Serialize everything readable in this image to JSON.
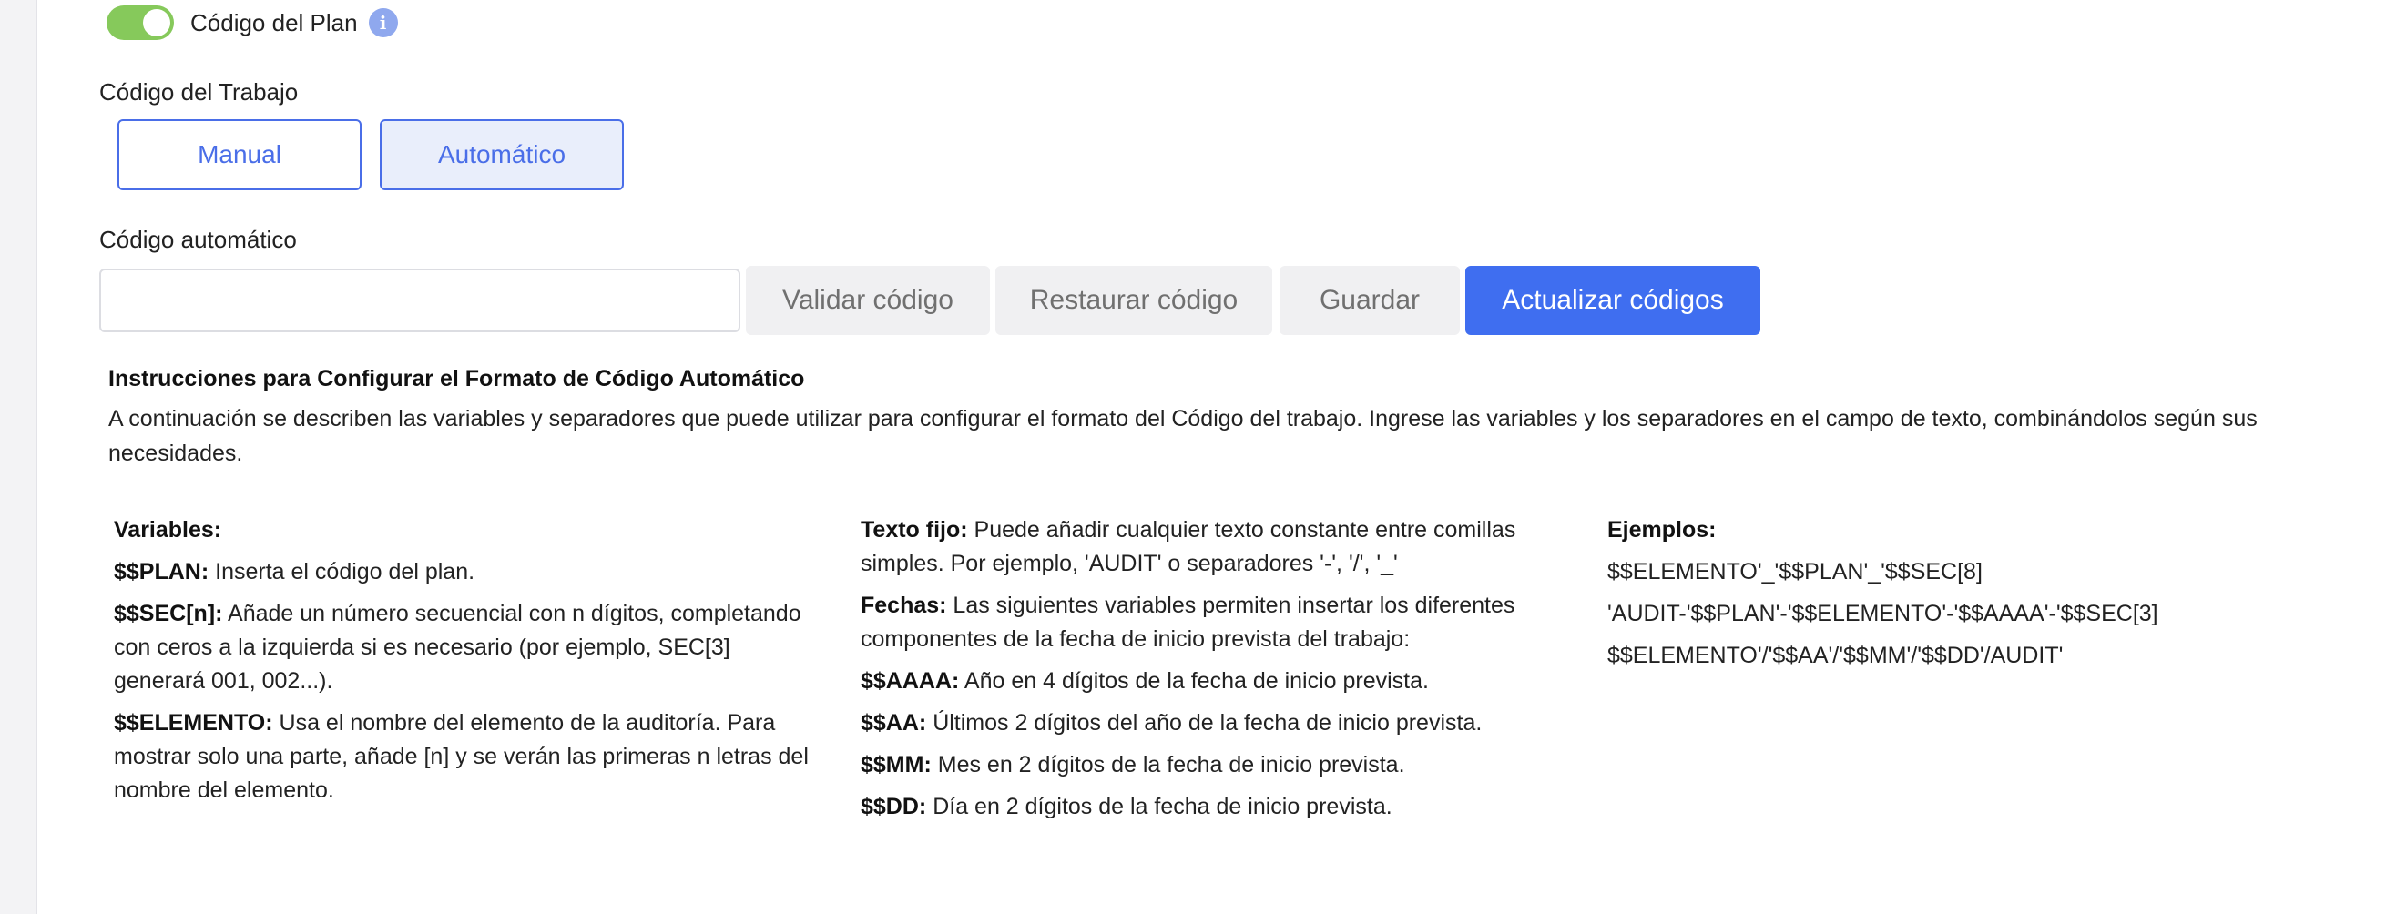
{
  "toggle": {
    "label": "Código del Plan",
    "on": true,
    "info_icon": "i"
  },
  "trabajo": {
    "label": "Código del Trabajo",
    "options": [
      "Manual",
      "Automático"
    ],
    "selected": "Automático"
  },
  "auto_code": {
    "label": "Código automático",
    "input_value": "",
    "buttons": {
      "validar": "Validar código",
      "restaurar": "Restaurar código",
      "guardar": "Guardar",
      "actualizar": "Actualizar códigos"
    }
  },
  "instructions": {
    "title": "Instrucciones para Configurar el Formato de Código Automático",
    "description": "A continuación se describen las variables y separadores que puede utilizar para configurar el formato del Código del trabajo. Ingrese las variables y los separadores en el campo de texto, combinándolos según sus necesidades."
  },
  "variables": {
    "heading": "Variables:",
    "items": [
      {
        "key": "$$PLAN:",
        "text": " Inserta el código del plan."
      },
      {
        "key": "$$SEC[n]:",
        "text": " Añade un número secuencial con n dígitos, completando con ceros a la izquierda si es necesario (por ejemplo, SEC[3] generará 001, 002...)."
      },
      {
        "key": "$$ELEMENTO:",
        "text": " Usa el nombre del elemento de la auditoría. Para mostrar solo una parte, añade [n] y se verán las primeras n letras del nombre del elemento."
      }
    ]
  },
  "fechas": {
    "items": [
      {
        "key": "Texto fijo:",
        "text": " Puede añadir cualquier texto constante entre comillas simples. Por ejemplo, 'AUDIT' o separadores '-', '/', '_'"
      },
      {
        "key": "Fechas:",
        "text": " Las siguientes variables permiten insertar los diferentes componentes de la fecha de inicio prevista del trabajo:"
      },
      {
        "key": "$$AAAA:",
        "text": " Año en 4 dígitos de la fecha de inicio prevista."
      },
      {
        "key": "$$AA:",
        "text": " Últimos 2 dígitos del año de la fecha de inicio prevista."
      },
      {
        "key": "$$MM:",
        "text": " Mes en 2 dígitos de la fecha de inicio prevista."
      },
      {
        "key": "$$DD:",
        "text": " Día en 2 dígitos de la fecha de inicio prevista."
      }
    ]
  },
  "ejemplos": {
    "heading": "Ejemplos:",
    "items": [
      "$$ELEMENTO'_'$$PLAN'_'$$SEC[8]",
      "'AUDIT-'$$PLAN'-'$$ELEMENTO'-'$$AAAA'-'$$SEC[3]",
      "$$ELEMENTO'/'$$AA'/'$$MM'/'$$DD'/AUDIT'"
    ]
  },
  "colors": {
    "accent": "#3f6ef0",
    "toggle_on": "#86c95b",
    "outline": "#4a6ee8"
  }
}
